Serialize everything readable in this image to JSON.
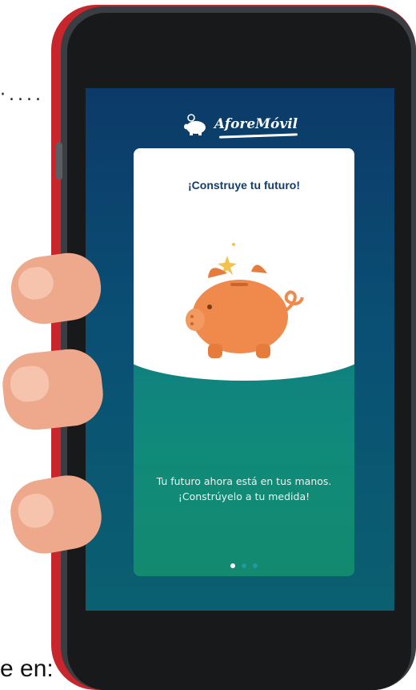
{
  "decoration": {
    "dots": "·....",
    "caption_fragment": "e en:"
  },
  "app": {
    "logo_text": "AforeMóvil",
    "card": {
      "title": "¡Construye tu futuro!",
      "body": "Tu futuro ahora está en tus manos. ¡Constrúyelo a tu medida!",
      "illustration": "piggy-bank-icon"
    },
    "pager": {
      "total": 3,
      "active_index": 0
    }
  },
  "colors": {
    "phone_case": "#c8262c",
    "screen_bg": "#0c3a68",
    "card_title": "#123c6a",
    "pig": "#ef8a4c",
    "teal": "#108a7a"
  }
}
